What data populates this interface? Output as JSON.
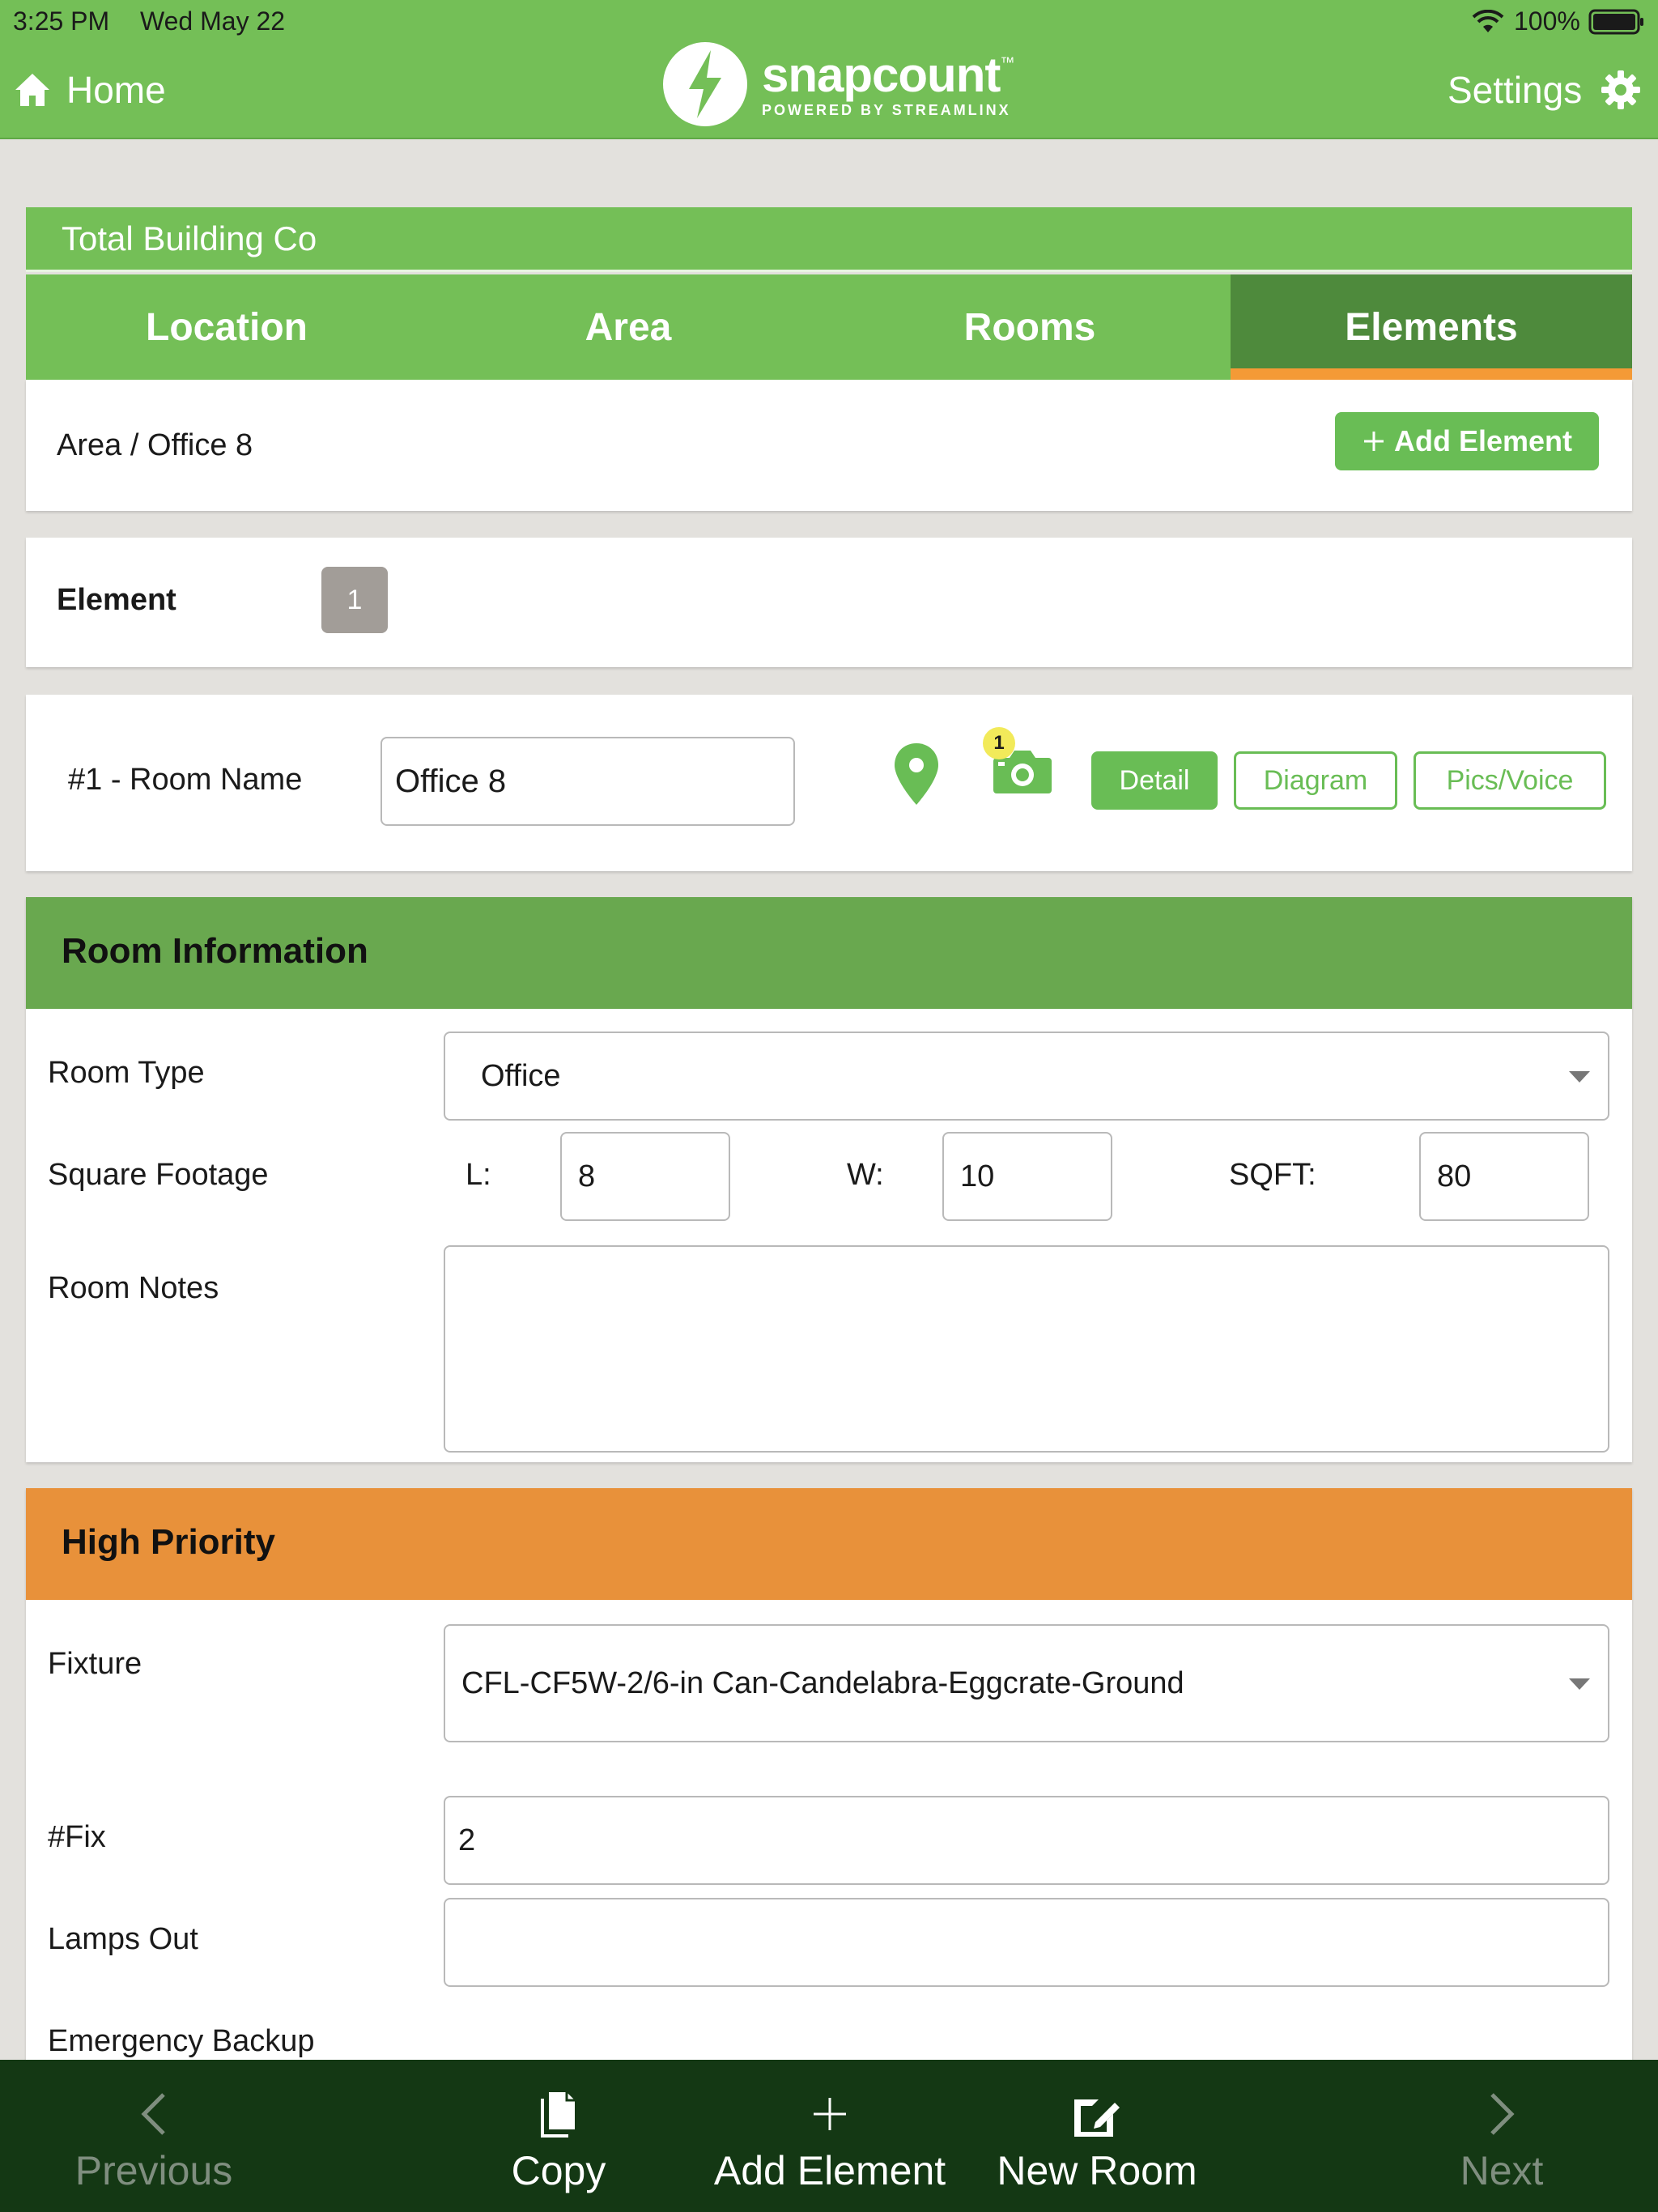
{
  "status_bar": {
    "time": "3:25 PM",
    "date": "Wed May 22",
    "battery": "100%"
  },
  "nav": {
    "home_label": "Home",
    "settings_label": "Settings",
    "logo_word": "snapcount",
    "logo_tm": "™",
    "logo_sub": "POWERED BY STREAMLINX"
  },
  "company": "Total Building Co",
  "tabs": [
    {
      "label": "Location",
      "active": false
    },
    {
      "label": "Area",
      "active": false
    },
    {
      "label": "Rooms",
      "active": false
    },
    {
      "label": "Elements",
      "active": true
    }
  ],
  "breadcrumb": "Area / Office 8",
  "add_element_button": "Add Element",
  "element": {
    "label": "Element",
    "badge": "1"
  },
  "room": {
    "label": "#1 - Room Name",
    "name_value": "Office 8",
    "photo_count": "1",
    "detail_button": "Detail",
    "diagram_button": "Diagram",
    "pics_button": "Pics/Voice"
  },
  "room_information": {
    "title": "Room Information",
    "room_type_label": "Room Type",
    "room_type_value": "Office",
    "square_footage_label": "Square Footage",
    "l_label": "L:",
    "l_value": "8",
    "w_label": "W:",
    "w_value": "10",
    "sqft_label": "SQFT:",
    "sqft_value": "80",
    "notes_label": "Room Notes",
    "notes_value": ""
  },
  "high_priority": {
    "title": "High Priority",
    "fixture_label": "Fixture",
    "fixture_value": "CFL-CF5W-2/6-in Can-Candelabra-Eggcrate-Ground",
    "fix_count_label": "#Fix",
    "fix_count_value": "2",
    "lamps_out_label": "Lamps Out",
    "lamps_out_value": "",
    "emergency_label": "Emergency Backup"
  },
  "bottom_bar": {
    "previous": "Previous",
    "copy": "Copy",
    "add_element": "Add Element",
    "new_room": "New Room",
    "next": "Next"
  },
  "colors": {
    "brand_green": "#74bf57",
    "tab_active": "#4e8a3c",
    "tab_indicator": "#f49a36",
    "section_green": "#69a84f",
    "section_orange": "#e8913a",
    "bottom_bar": "#143814"
  }
}
